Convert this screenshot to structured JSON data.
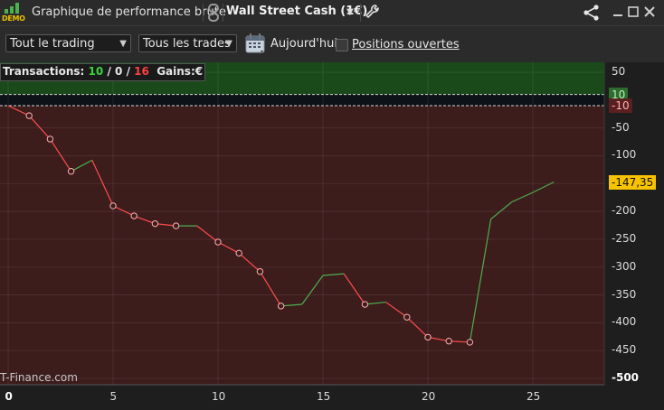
{
  "window": {
    "badge_text": "DEMO",
    "title": "Graphique de performance brute",
    "instrument": "Wall Street Cash (1€)"
  },
  "toolbar": {
    "trading_filter": "Tout le trading",
    "trades_filter": "Tous les trades",
    "today_label": "Aujourd'hui",
    "open_positions_label": "Positions ouvertes",
    "open_positions_checked": false
  },
  "summary": {
    "transactions_label": "Transactions:",
    "winners": "10",
    "sep1": "/",
    "neutral": "0",
    "sep2": "/",
    "losers": "16",
    "gains_label": "Gains:",
    "gains_currency": "€"
  },
  "watermark": "T-Finance.com",
  "colors": {
    "profit_zone": "#1a4a1a",
    "loss_zone": "#3d1c1c",
    "winning_line": "#4caf50",
    "losing_line": "#ff4d4d",
    "current_value_badge": "#f7c300"
  },
  "chart_data": {
    "type": "line",
    "title": "",
    "xlabel": "",
    "ylabel": "",
    "x": [
      0,
      1,
      2,
      3,
      4,
      5,
      6,
      7,
      8,
      9,
      10,
      11,
      12,
      13,
      14,
      15,
      16,
      17,
      18,
      19,
      20,
      21,
      22,
      23,
      24,
      25,
      26
    ],
    "y": [
      -10,
      -28,
      -70,
      -128,
      -108,
      -190,
      -208,
      -222,
      -226,
      -226,
      -255,
      -275,
      -308,
      -370,
      -367,
      -315,
      -312,
      -367,
      -363,
      -390,
      -426,
      -433,
      -435,
      -214,
      -183,
      -166,
      -147.35
    ],
    "segment_result": [
      "loss",
      "loss",
      "loss",
      "win",
      "loss",
      "loss",
      "loss",
      "loss",
      "win",
      "loss",
      "loss",
      "loss",
      "loss",
      "win",
      "win",
      "win",
      "loss",
      "win",
      "loss",
      "loss",
      "loss",
      "loss",
      "win",
      "win",
      "win",
      "win"
    ],
    "xlim": [
      0,
      28
    ],
    "ylim": [
      -500,
      50
    ],
    "x_ticks": [
      "0",
      "5",
      "10",
      "15",
      "20",
      "25"
    ],
    "y_ticks": [
      "50",
      "-50",
      "-100",
      "-150",
      "-200",
      "-250",
      "-300",
      "-350",
      "-400",
      "-450",
      "-500"
    ],
    "reference_lines": {
      "upper": "10",
      "lower": "-10"
    },
    "current_value": "-147,35",
    "grid": true
  }
}
